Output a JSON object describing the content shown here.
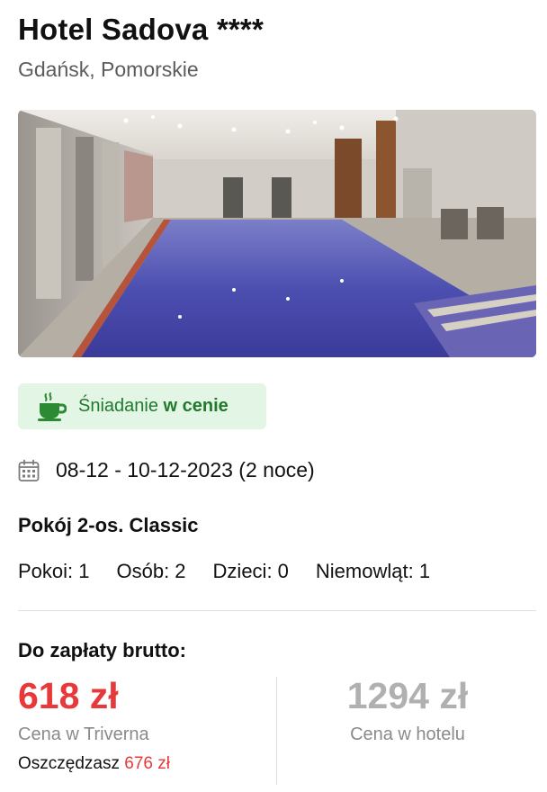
{
  "hotel": {
    "name": "Hotel Sadova ****",
    "location": "Gdańsk, Pomorskie"
  },
  "image": {
    "icon": "hotel-pool-photo"
  },
  "badge": {
    "icon": "coffee-cup-icon",
    "text_regular": "Śniadanie",
    "text_bold": "w cenie",
    "color": "#1f7a2c",
    "background": "#e3f5e4"
  },
  "stay": {
    "icon": "calendar-icon",
    "dates": "08-12 - 10-12-2023 (2 noce)"
  },
  "room": {
    "name": "Pokój 2-os. Classic"
  },
  "counts": {
    "rooms": "Pokoi: 1",
    "persons": "Osób: 2",
    "children": "Dzieci: 0",
    "infants": "Niemowląt: 1"
  },
  "payment": {
    "label": "Do zapłaty brutto:",
    "our_price": "618 zł",
    "our_price_label": "Cena w Triverna",
    "savings_label": "Oszczędzasz",
    "savings_amount": "676 zł",
    "hotel_price": "1294 zł",
    "hotel_price_label": "Cena w hotelu",
    "accent_color": "#e8393a"
  }
}
